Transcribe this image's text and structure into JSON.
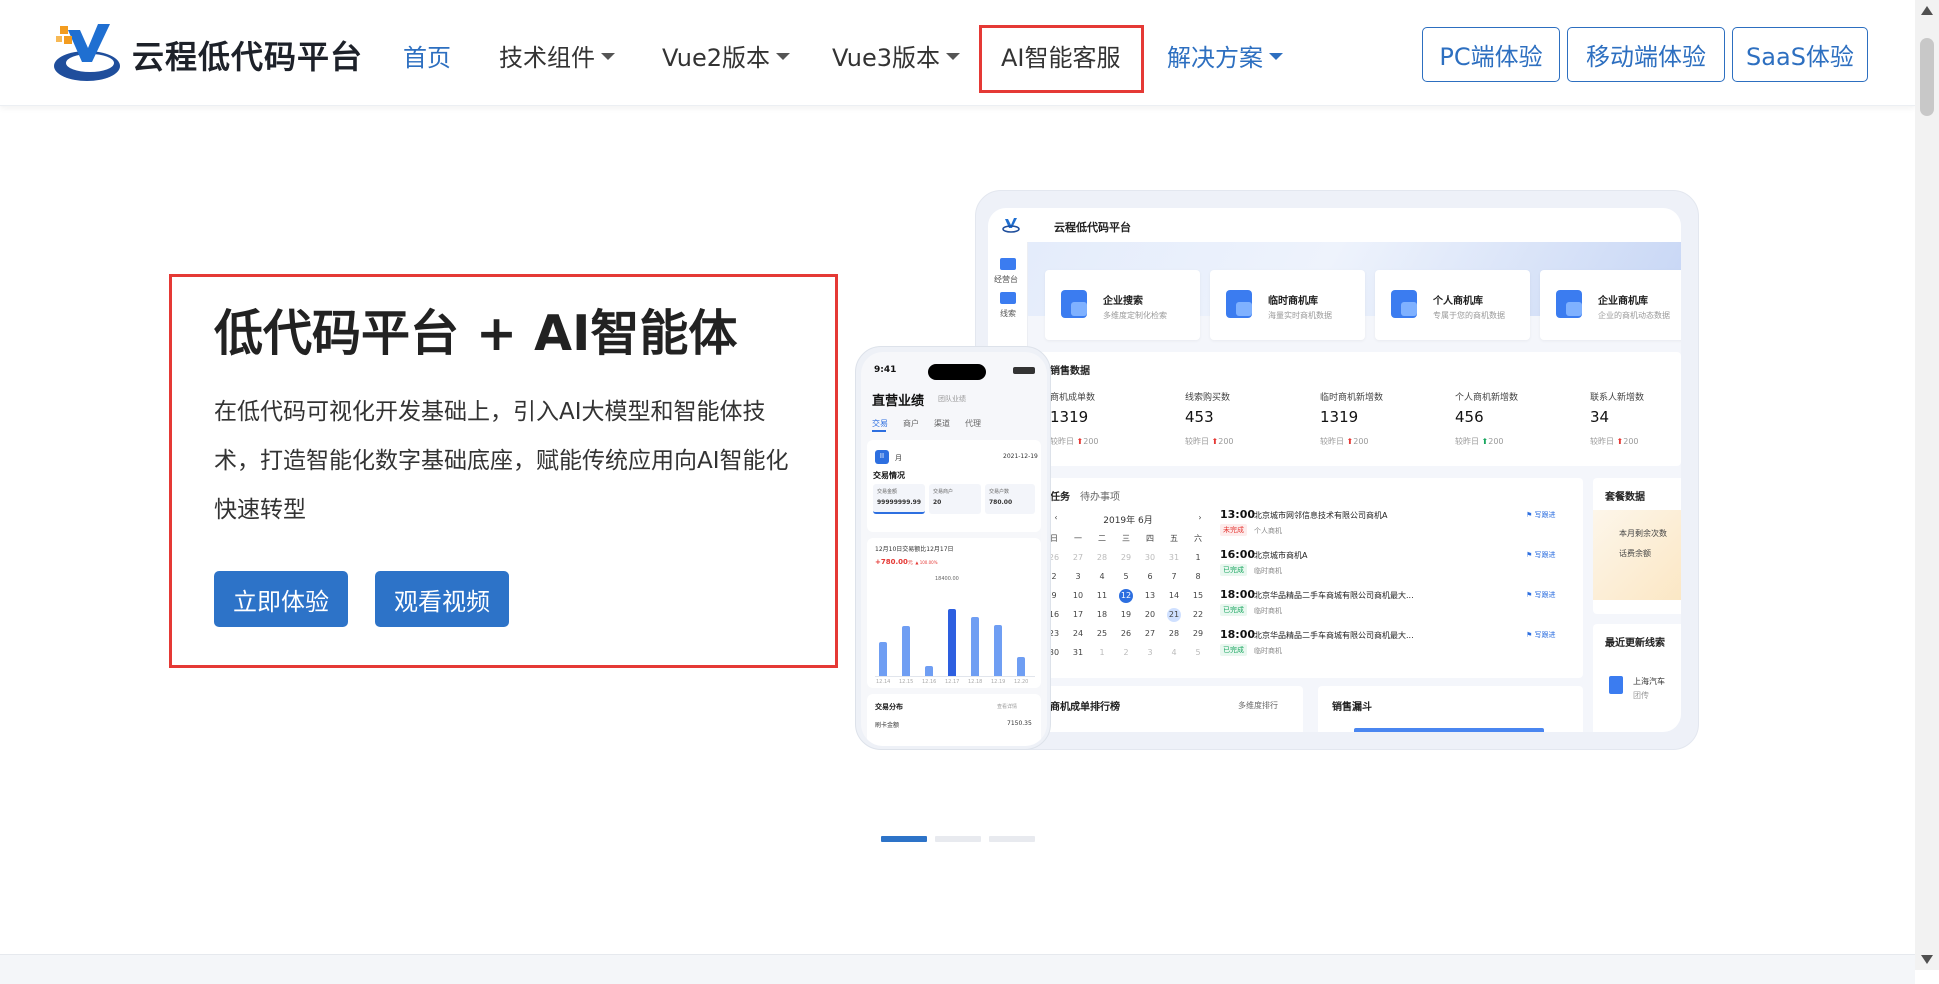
{
  "header": {
    "logo_text": "云程低代码平台",
    "nav": [
      {
        "label": "首页",
        "active": true,
        "dropdown": false
      },
      {
        "label": "技术组件",
        "active": false,
        "dropdown": true
      },
      {
        "label": "Vue2版本",
        "active": false,
        "dropdown": true
      },
      {
        "label": "Vue3版本",
        "active": false,
        "dropdown": true
      },
      {
        "label": "AI智能客服",
        "active": false,
        "dropdown": false,
        "highlighted": true
      },
      {
        "label": "解决方案",
        "active": false,
        "dropdown": true
      }
    ],
    "buttons": [
      "PC端体验",
      "移动端体验",
      "SaaS体验"
    ],
    "accent_color": "#2d6fc0",
    "highlight_color": "#e53935"
  },
  "hero": {
    "title": "低代码平台 + AI智能体",
    "description": "在低代码可视化开发基础上，引入AI大模型和智能体技术，打造智能化数字基础底座，赋能传统应用向AI智能化快速转型",
    "primary_button": "立即体验",
    "secondary_button": "观看视频"
  },
  "dashboard": {
    "title": "云程低代码平台",
    "sidebar": [
      "经营台",
      "线索"
    ],
    "quick_cards": [
      {
        "title": "企业搜索",
        "sub": "多维度定制化检索"
      },
      {
        "title": "临时商机库",
        "sub": "海量实时商机数据"
      },
      {
        "title": "个人商机库",
        "sub": "专属于您的商机数据"
      },
      {
        "title": "企业商机库",
        "sub": "企业的商机动态数据"
      }
    ],
    "sales": {
      "title": "销售数据",
      "stats": [
        {
          "label": "商机成单数",
          "value": "1319",
          "compare": "较昨日",
          "delta": "200",
          "trend": "up"
        },
        {
          "label": "线索购买数",
          "value": "453",
          "compare": "较昨日",
          "delta": "200",
          "trend": "up"
        },
        {
          "label": "临时商机新增数",
          "value": "1319",
          "compare": "较昨日",
          "delta": "200",
          "trend": "up"
        },
        {
          "label": "个人商机新增数",
          "value": "456",
          "compare": "较昨日",
          "delta": "200",
          "trend": "up-green"
        },
        {
          "label": "联系人新增数",
          "value": "34",
          "compare": "较昨日",
          "delta": "200",
          "trend": "up"
        }
      ]
    },
    "tasks": {
      "tabs": [
        "任务",
        "待办事项"
      ],
      "month": "2019年 6月",
      "prev": "‹",
      "next": "›",
      "weekdays": [
        "日",
        "一",
        "二",
        "三",
        "四",
        "五",
        "六"
      ],
      "weeks": [
        [
          "26",
          "27",
          "28",
          "29",
          "30",
          "31",
          "1"
        ],
        [
          "2",
          "3",
          "4",
          "5",
          "6",
          "7",
          "8"
        ],
        [
          "9",
          "10",
          "11",
          "12",
          "13",
          "14",
          "15"
        ],
        [
          "16",
          "17",
          "18",
          "19",
          "20",
          "21",
          "22"
        ],
        [
          "23",
          "24",
          "25",
          "26",
          "27",
          "28",
          "29"
        ],
        [
          "30",
          "31",
          "1",
          "2",
          "3",
          "4",
          "5"
        ]
      ],
      "items": [
        {
          "time": "13:00",
          "name": "北京城市网邻信息技术有限公司商机A",
          "status": "未完成",
          "status_type": "red",
          "sub": "个人商机",
          "action": "写跟进"
        },
        {
          "time": "16:00",
          "name": "北京城市商机A",
          "status": "已完成",
          "status_type": "green",
          "sub": "临时商机",
          "action": "写跟进"
        },
        {
          "time": "18:00",
          "name": "北京华品精品二手车商城有限公司商机最大...",
          "status": "已完成",
          "status_type": "green",
          "sub": "临时商机",
          "action": "写跟进"
        },
        {
          "time": "18:00",
          "name": "北京华品精品二手车商城有限公司商机最大...",
          "status": "已完成",
          "status_type": "green",
          "sub": "临时商机",
          "action": "写跟进"
        }
      ]
    },
    "package": {
      "title": "套餐数据",
      "line1": "本月剩余次数",
      "line2": "话费余额"
    },
    "recent": {
      "title": "最近更新线索",
      "item": "上海汽车",
      "item_sub": "团传"
    },
    "ranking": {
      "title": "商机成单排行榜",
      "link": "多维度排行"
    },
    "funnel": {
      "title": "销售漏斗"
    }
  },
  "phone": {
    "time": "9:41",
    "title": "直营业绩",
    "subtitle": "团队业绩",
    "tabs": [
      "交易",
      "商户",
      "渠道",
      "代理"
    ],
    "period_icon": "II",
    "period": "月",
    "date": "2021-12-19",
    "overview_title": "交易情况",
    "boxes": [
      {
        "label": "交易金额",
        "value": "99999999.99"
      },
      {
        "label": "交易商户",
        "value": "20"
      },
      {
        "label": "交易户数",
        "value": "780.00"
      }
    ],
    "chart_title": "12月10日交易额比12月17日",
    "chart_value": "+780.00",
    "chart_value_unit": "元",
    "chart_pct": "▲ 100.00%",
    "peak_label": "18400.00",
    "chart_x": [
      "12.14",
      "12.15",
      "12.16",
      "12.17",
      "12.18",
      "12.19",
      "12.20"
    ],
    "chart_bars": [
      0.42,
      0.62,
      0.12,
      0.84,
      0.74,
      0.64,
      0.24
    ],
    "dist_title": "交易分布",
    "dist_link": "查看详情",
    "dist_value": "7150.35",
    "dist_row": "刷卡金额"
  },
  "carousel": {
    "slides": 3,
    "active": 0
  },
  "colors": {
    "primary_button": "#2d73c8",
    "chart_bar": "#6f9ef3",
    "chart_bar_highlight": "#2d5fe0",
    "red": "#e53935",
    "green": "#1aa760"
  }
}
